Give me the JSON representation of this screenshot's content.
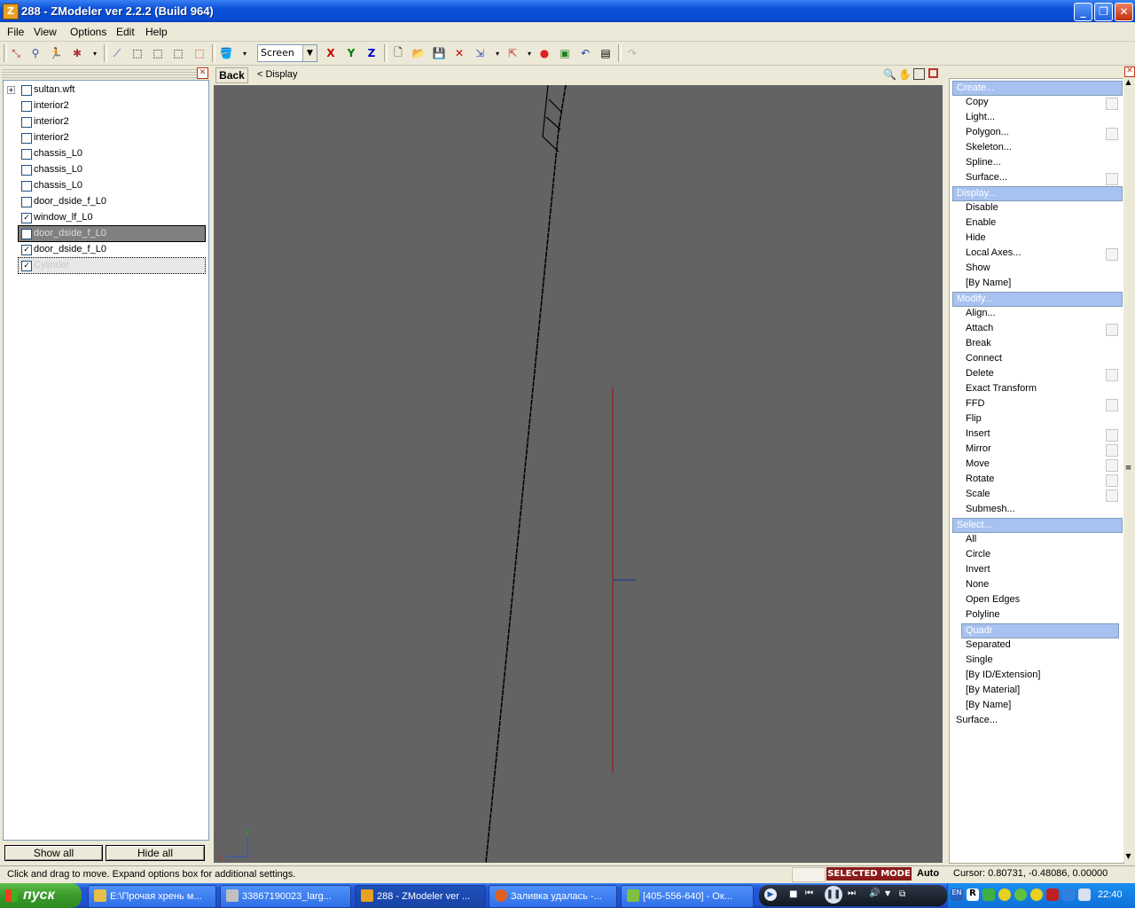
{
  "window": {
    "icon_letter": "Z",
    "title": "288 - ZModeler ver 2.2.2 (Build 964)"
  },
  "menu": [
    "File",
    "View",
    "Options",
    "Edit",
    "Help"
  ],
  "toolbar": {
    "screen_select": "Screen",
    "axis_x": "X",
    "axis_y": "Y",
    "axis_z": "Z"
  },
  "tree": {
    "items": [
      {
        "label": "sultan.wft",
        "checked": false,
        "expander": "+"
      },
      {
        "label": "interior2",
        "checked": false
      },
      {
        "label": "interior2",
        "checked": false
      },
      {
        "label": "interior2",
        "checked": false
      },
      {
        "label": "chassis_L0",
        "checked": false
      },
      {
        "label": "chassis_L0",
        "checked": false
      },
      {
        "label": "chassis_L0",
        "checked": false
      },
      {
        "label": "door_dside_f_L0",
        "checked": false
      },
      {
        "label": "window_lf_L0",
        "checked": true
      },
      {
        "label": "door_dside_f_L0",
        "checked": false,
        "state": "selected"
      },
      {
        "label": "door_dside_f_L0",
        "checked": true
      },
      {
        "label": "Cylinder",
        "checked": true,
        "state": "hidden-selected"
      }
    ],
    "show_all": "Show all",
    "hide_all": "Hide all"
  },
  "viewport": {
    "back_label": "Back",
    "breadcrumb": "<  Display",
    "gizmo_y": "y",
    "gizmo_x": "x"
  },
  "commands": {
    "create": {
      "title": "Create...",
      "items": [
        "Copy",
        "Light...",
        "Polygon...",
        "Skeleton...",
        "Spline...",
        "Surface..."
      ]
    },
    "display": {
      "title": "Display...",
      "items": [
        "Disable",
        "Enable",
        "Hide",
        "Local Axes...",
        "Show",
        "[By Name]"
      ]
    },
    "modify": {
      "title": "Modify...",
      "items": [
        "Align...",
        "Attach",
        "Break",
        "Connect",
        "Delete",
        "Exact Transform",
        "FFD",
        "Flip",
        "Insert",
        "Mirror",
        "Move",
        "Rotate",
        "Scale",
        "Submesh..."
      ]
    },
    "select": {
      "title": "Select...",
      "items": [
        "All",
        "Circle",
        "Invert",
        "None",
        "Open Edges",
        "Polyline",
        "Quadr",
        "Separated",
        "Single",
        "[By ID/Extension]",
        "[By Material]",
        "[By Name]"
      ]
    },
    "surface": "Surface..."
  },
  "status": {
    "hint": "Click and drag to move. Expand options box for additional settings.",
    "mode": "SELECTED MODE",
    "auto": "Auto",
    "cursor": "Cursor: 0.80731, -0.48086, 0.00000"
  },
  "taskbar": {
    "start": "пуск",
    "tasks": [
      {
        "label": "E:\\Прочая хрень м...",
        "icon_color": "#e8c048"
      },
      {
        "label": "33867190023_larg...",
        "icon_color": "#c0c0c0"
      },
      {
        "label": "288 - ZModeler ver ...",
        "icon_color": "#e8a020"
      },
      {
        "label": "Заливка удалась -...",
        "icon_color": "#e06020"
      },
      {
        "label": "[405-556-640] - Ок...",
        "icon_color": "#80c040"
      }
    ],
    "clock": "22:40"
  },
  "colors": {
    "titlebar": "#0a50d8",
    "viewport_bg": "#636363",
    "section_header": "#a7c2f0",
    "mode_badge": "#8b1a1a",
    "axis_x": "#cc0000",
    "axis_y": "#008000",
    "axis_z": "#0000cc"
  }
}
